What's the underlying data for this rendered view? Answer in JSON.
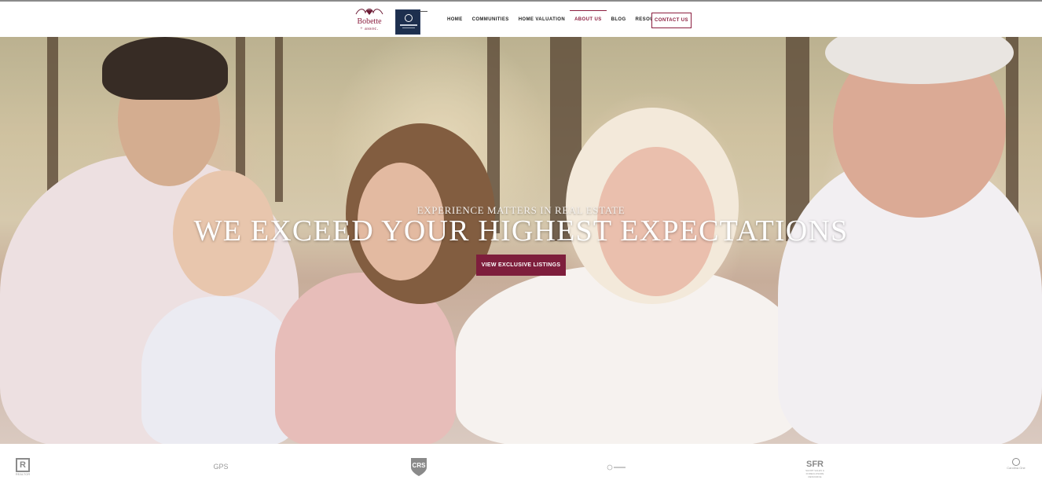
{
  "header": {
    "logo_name": "Bobette",
    "logo_sub": "+ assoc.",
    "nav": [
      {
        "label": "HOME",
        "active": false
      },
      {
        "label": "COMMUNITIES",
        "active": false
      },
      {
        "label": "HOME VALUATION",
        "active": false
      },
      {
        "label": "ABOUT US",
        "active": true
      },
      {
        "label": "BLOG",
        "active": false
      },
      {
        "label": "RESOURCES",
        "active": false
      }
    ],
    "contact_label": "CONTACT US"
  },
  "hero": {
    "kicker": "EXPERIENCE MATTERS IN REAL ESTATE",
    "headline": "WE EXCEED YOUR HIGHEST EXPECTATIONS",
    "cta_label": "VIEW EXCLUSIVE LISTINGS"
  },
  "footer_logos": {
    "realtor_mark": "R",
    "realtor_label": "REALTOR",
    "gps_label": "GPS",
    "crs_label": "CRS",
    "sfr_label": "SFR",
    "sfr_sub": "SHORT SALES & FORECLOSURE RESOURCE",
    "coldwell_label": "Carolina One"
  },
  "colors": {
    "accent": "#8b1e3f",
    "cta_bg": "#7e1e3c"
  }
}
